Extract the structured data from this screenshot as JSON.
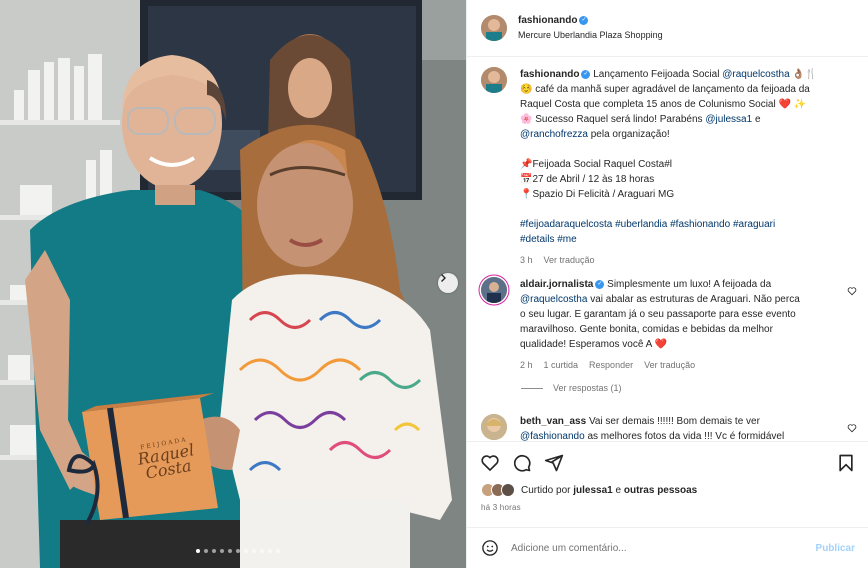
{
  "header": {
    "username": "fashionando",
    "location": "Mercure Uberlandia Plaza Shopping"
  },
  "photo": {
    "box_text_line1": "FEIJOADA",
    "box_text_line2": "Raquel",
    "box_text_line3": "Costa",
    "carousel_total": 11,
    "carousel_active": 1
  },
  "caption": {
    "username": "fashionando",
    "line1_text": "Lançamento Feijoada Social",
    "line1_mention": "@raquelcostha",
    "line1_emoji": "👌🏽🍴",
    "line2": "☺️ café da manhã super agradável de lançamento da feijoada da",
    "line3_text": "Raquel Costa que completa 15 anos de Colunismo Social",
    "line3_emoji": "❤️ ✨",
    "line4_text": "🌸  Sucesso Raquel será lindo! Parabéns",
    "line4_mention": "@julessa1",
    "line4_tail": "e",
    "line5_mention": "@ranchofrezza",
    "line5_text": "pela organização!",
    "event_line1": "📌Feijoada Social Raquel Costa#l",
    "event_line2": "📅27 de Abril / 12 às 18 horas",
    "event_line3": "📍Spazio Di Felicità / Araguari MG",
    "hashtags_line1": "#feijoadaraquelcosta #uberlandia #fashionando #araguari",
    "hashtags_line2": "#details #me",
    "time": "3 h",
    "translate": "Ver tradução"
  },
  "comment1": {
    "username": "aldair.jornalista",
    "text1": "Simplesmente um luxo! A feijoada da",
    "mention": "@raquelcostha",
    "text2": "vai abalar as estruturas de Araguari. Não perca",
    "text3": "o seu lugar. E garantam já o seu passaporte para esse evento",
    "text4": "maravilhoso. Gente bonita, comidas e bebidas da melhor",
    "text5": "qualidade! Esperamos você A",
    "emoji": "❤️",
    "time": "2 h",
    "likes": "1 curtida",
    "reply": "Responder",
    "translate": "Ver tradução",
    "view_replies": "Ver respostas (1)"
  },
  "comment2": {
    "username": "beth_van_ass",
    "text1": "Vai ser demais !!!!!! Bom demais te ver",
    "mention": "@fashionando",
    "text2": "as melhores fotos da vida !!! Vc é formidável"
  },
  "likes": {
    "prefix": "Curtido por",
    "user": "julessa1",
    "middle": "e",
    "others": "outras pessoas"
  },
  "post_time": "há 3 horas",
  "add_comment": {
    "placeholder": "Adicione um comentário...",
    "publish": "Publicar"
  },
  "colors": {
    "link": "#00376b",
    "verified": "#3897f0",
    "publish_disabled": "#a3d2fb",
    "heart_red": "#ed4956"
  }
}
